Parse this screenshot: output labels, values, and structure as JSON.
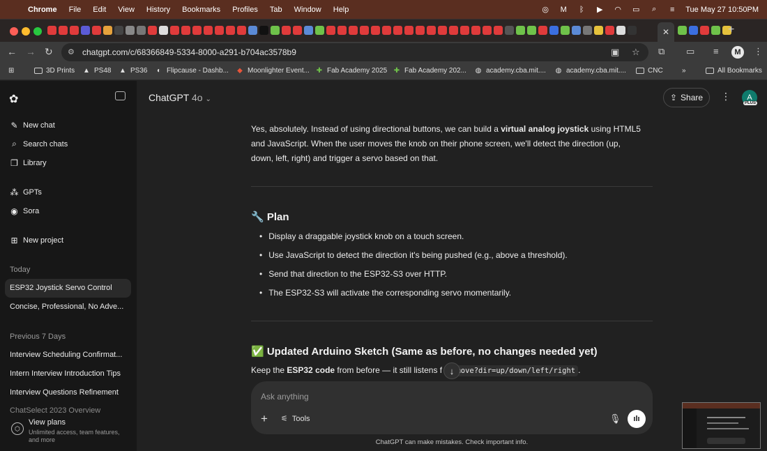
{
  "menubar": {
    "app": "Chrome",
    "items": [
      "File",
      "Edit",
      "View",
      "History",
      "Bookmarks",
      "Profiles",
      "Tab",
      "Window",
      "Help"
    ],
    "datetime": "Tue May 27  10:50PM"
  },
  "toolbar": {
    "url": "chatgpt.com/c/68366849-5334-8000-a291-b704ac3578b9"
  },
  "bookmarks": [
    {
      "label": "3D Prints",
      "icon": "folder-icon"
    },
    {
      "label": "PS48",
      "icon": "triangle-icon"
    },
    {
      "label": "PS36",
      "icon": "triangle-icon"
    },
    {
      "label": "Flipcause - Dashb...",
      "icon": "flipcause-icon"
    },
    {
      "label": "Moonlighter Event...",
      "icon": "moonlighter-icon"
    },
    {
      "label": "Fab Academy 2025",
      "icon": "fab-icon"
    },
    {
      "label": "Fab Academy 202...",
      "icon": "fab-icon"
    },
    {
      "label": "academy.cba.mit....",
      "icon": "globe-icon"
    },
    {
      "label": "academy.cba.mit....",
      "icon": "globe-icon"
    },
    {
      "label": "CNC",
      "icon": "folder-icon"
    }
  ],
  "bookmarks_all": "All Bookmarks",
  "sidebar": {
    "actions": [
      {
        "label": "New chat"
      },
      {
        "label": "Search chats"
      },
      {
        "label": "Library"
      },
      {
        "label": "GPTs"
      },
      {
        "label": "Sora"
      },
      {
        "label": "New project"
      }
    ],
    "today_label": "Today",
    "today": [
      "ESP32 Joystick Servo Control",
      "Concise, Professional, No Adve..."
    ],
    "prev_label": "Previous 7 Days",
    "prev": [
      "Interview Scheduling Confirmat...",
      "Intern Interview Introduction Tips",
      "Interview Questions Refinement",
      "ChatSelect 2023 Overview"
    ],
    "plans_title": "View plans",
    "plans_sub1": "Unlimited access, team features,",
    "plans_sub2": "and more"
  },
  "header": {
    "model": "ChatGPT",
    "version": "4o",
    "share": "Share",
    "avatar_letter": "A",
    "plus_badge": "PLUS"
  },
  "message": {
    "p1_a": "Yes, absolutely. Instead of using directional buttons, we can build a ",
    "p1_bold": "virtual analog joystick",
    "p1_b": " using HTML5",
    "p1_line2": "and JavaScript. When the user moves the knob on their phone screen, we'll detect the direction (up,",
    "p1_line3": "down, left, right) and trigger a servo based on that.",
    "plan_heading": "🔧 Plan",
    "plan_items": [
      "Display a draggable joystick knob on a touch screen.",
      "Use JavaScript to detect the direction it's being pushed (e.g., above a threshold).",
      "Send that direction to the ESP32-S3 over HTTP.",
      "The ESP32-S3 will activate the corresponding servo momentarily."
    ],
    "sketch_heading": "✅ Updated Arduino Sketch (Same as before, no changes needed yet)",
    "keep_a": "Keep the ",
    "keep_bold": "ESP32 code",
    "keep_b": " from before — it still listens f",
    "keep_code": "/move?dir=up/down/left/right",
    "keep_end": "."
  },
  "composer": {
    "placeholder": "Ask anything",
    "tools": "Tools"
  },
  "disclaimer": "ChatGPT can make mistakes. Check important info."
}
